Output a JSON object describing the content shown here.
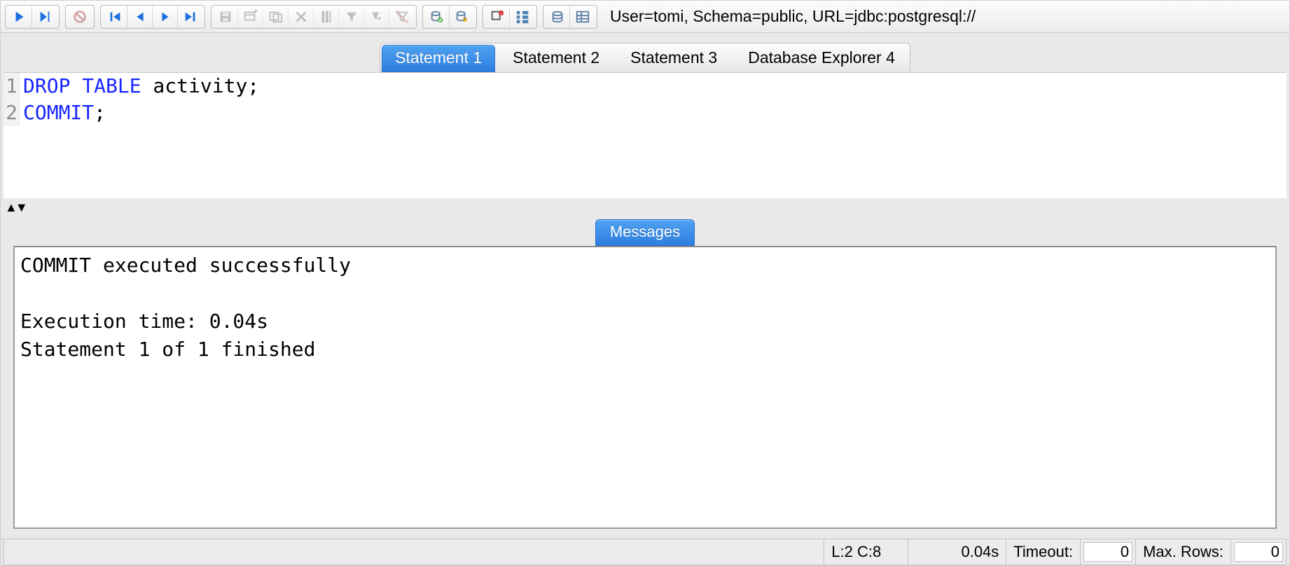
{
  "connection": "User=tomi, Schema=public, URL=jdbc:postgresql://",
  "tabs": [
    {
      "label": "Statement 1",
      "active": true
    },
    {
      "label": "Statement 2",
      "active": false
    },
    {
      "label": "Statement 3",
      "active": false
    },
    {
      "label": "Database Explorer 4",
      "active": false
    }
  ],
  "sql": {
    "lines": [
      {
        "n": "1",
        "tokens": [
          {
            "t": "DROP TABLE",
            "kw": true
          },
          {
            "t": " activity;",
            "kw": false
          }
        ]
      },
      {
        "n": "2",
        "tokens": [
          {
            "t": "COMMIT",
            "kw": true
          },
          {
            "t": ";",
            "kw": false
          }
        ]
      }
    ]
  },
  "messages_tab": "Messages",
  "messages": "COMMIT executed successfully\n\nExecution time: 0.04s\nStatement 1 of 1 finished",
  "status": {
    "cursor": "L:2 C:8",
    "time": "0.04s",
    "timeout_label": "Timeout:",
    "timeout_value": "0",
    "maxrows_label": "Max. Rows:",
    "maxrows_value": "0"
  }
}
